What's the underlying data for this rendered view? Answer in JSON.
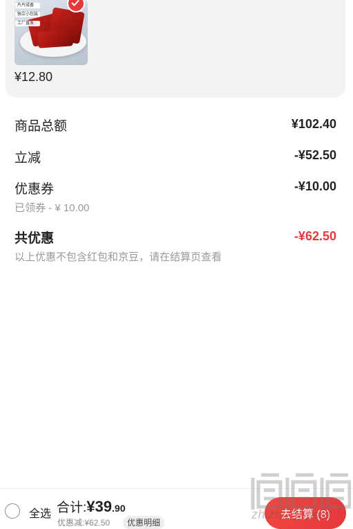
{
  "product": {
    "image_tags": [
      "片片成香",
      "独立小包装",
      "工厂直发"
    ],
    "price": "¥12.80"
  },
  "summary": {
    "goods_total_label": "商品总额",
    "goods_total_value": "¥102.40",
    "instant_discount_label": "立减",
    "instant_discount_value": "-¥52.50",
    "coupon_label": "优惠券",
    "coupon_value": "-¥10.00",
    "coupon_claimed": "已领券 - ¥ 10.00",
    "total_discount_label": "共优惠",
    "total_discount_value": "-¥62.50",
    "note": "以上优惠不包含红包和京豆，请在结算页查看"
  },
  "bottom_bar": {
    "select_all": "全选",
    "total_label": "合计:",
    "currency": "¥",
    "total_int": "39",
    "total_dec": ".90",
    "discount_text": "优惠减:¥62.50",
    "detail_button": "优惠明细",
    "checkout_button": "去结算 (8)"
  },
  "watermark": {
    "text": "zhizhizhi.com"
  },
  "colors": {
    "accent": "#e4393c",
    "muted": "#999999",
    "card_bg": "#f3f3f3"
  }
}
